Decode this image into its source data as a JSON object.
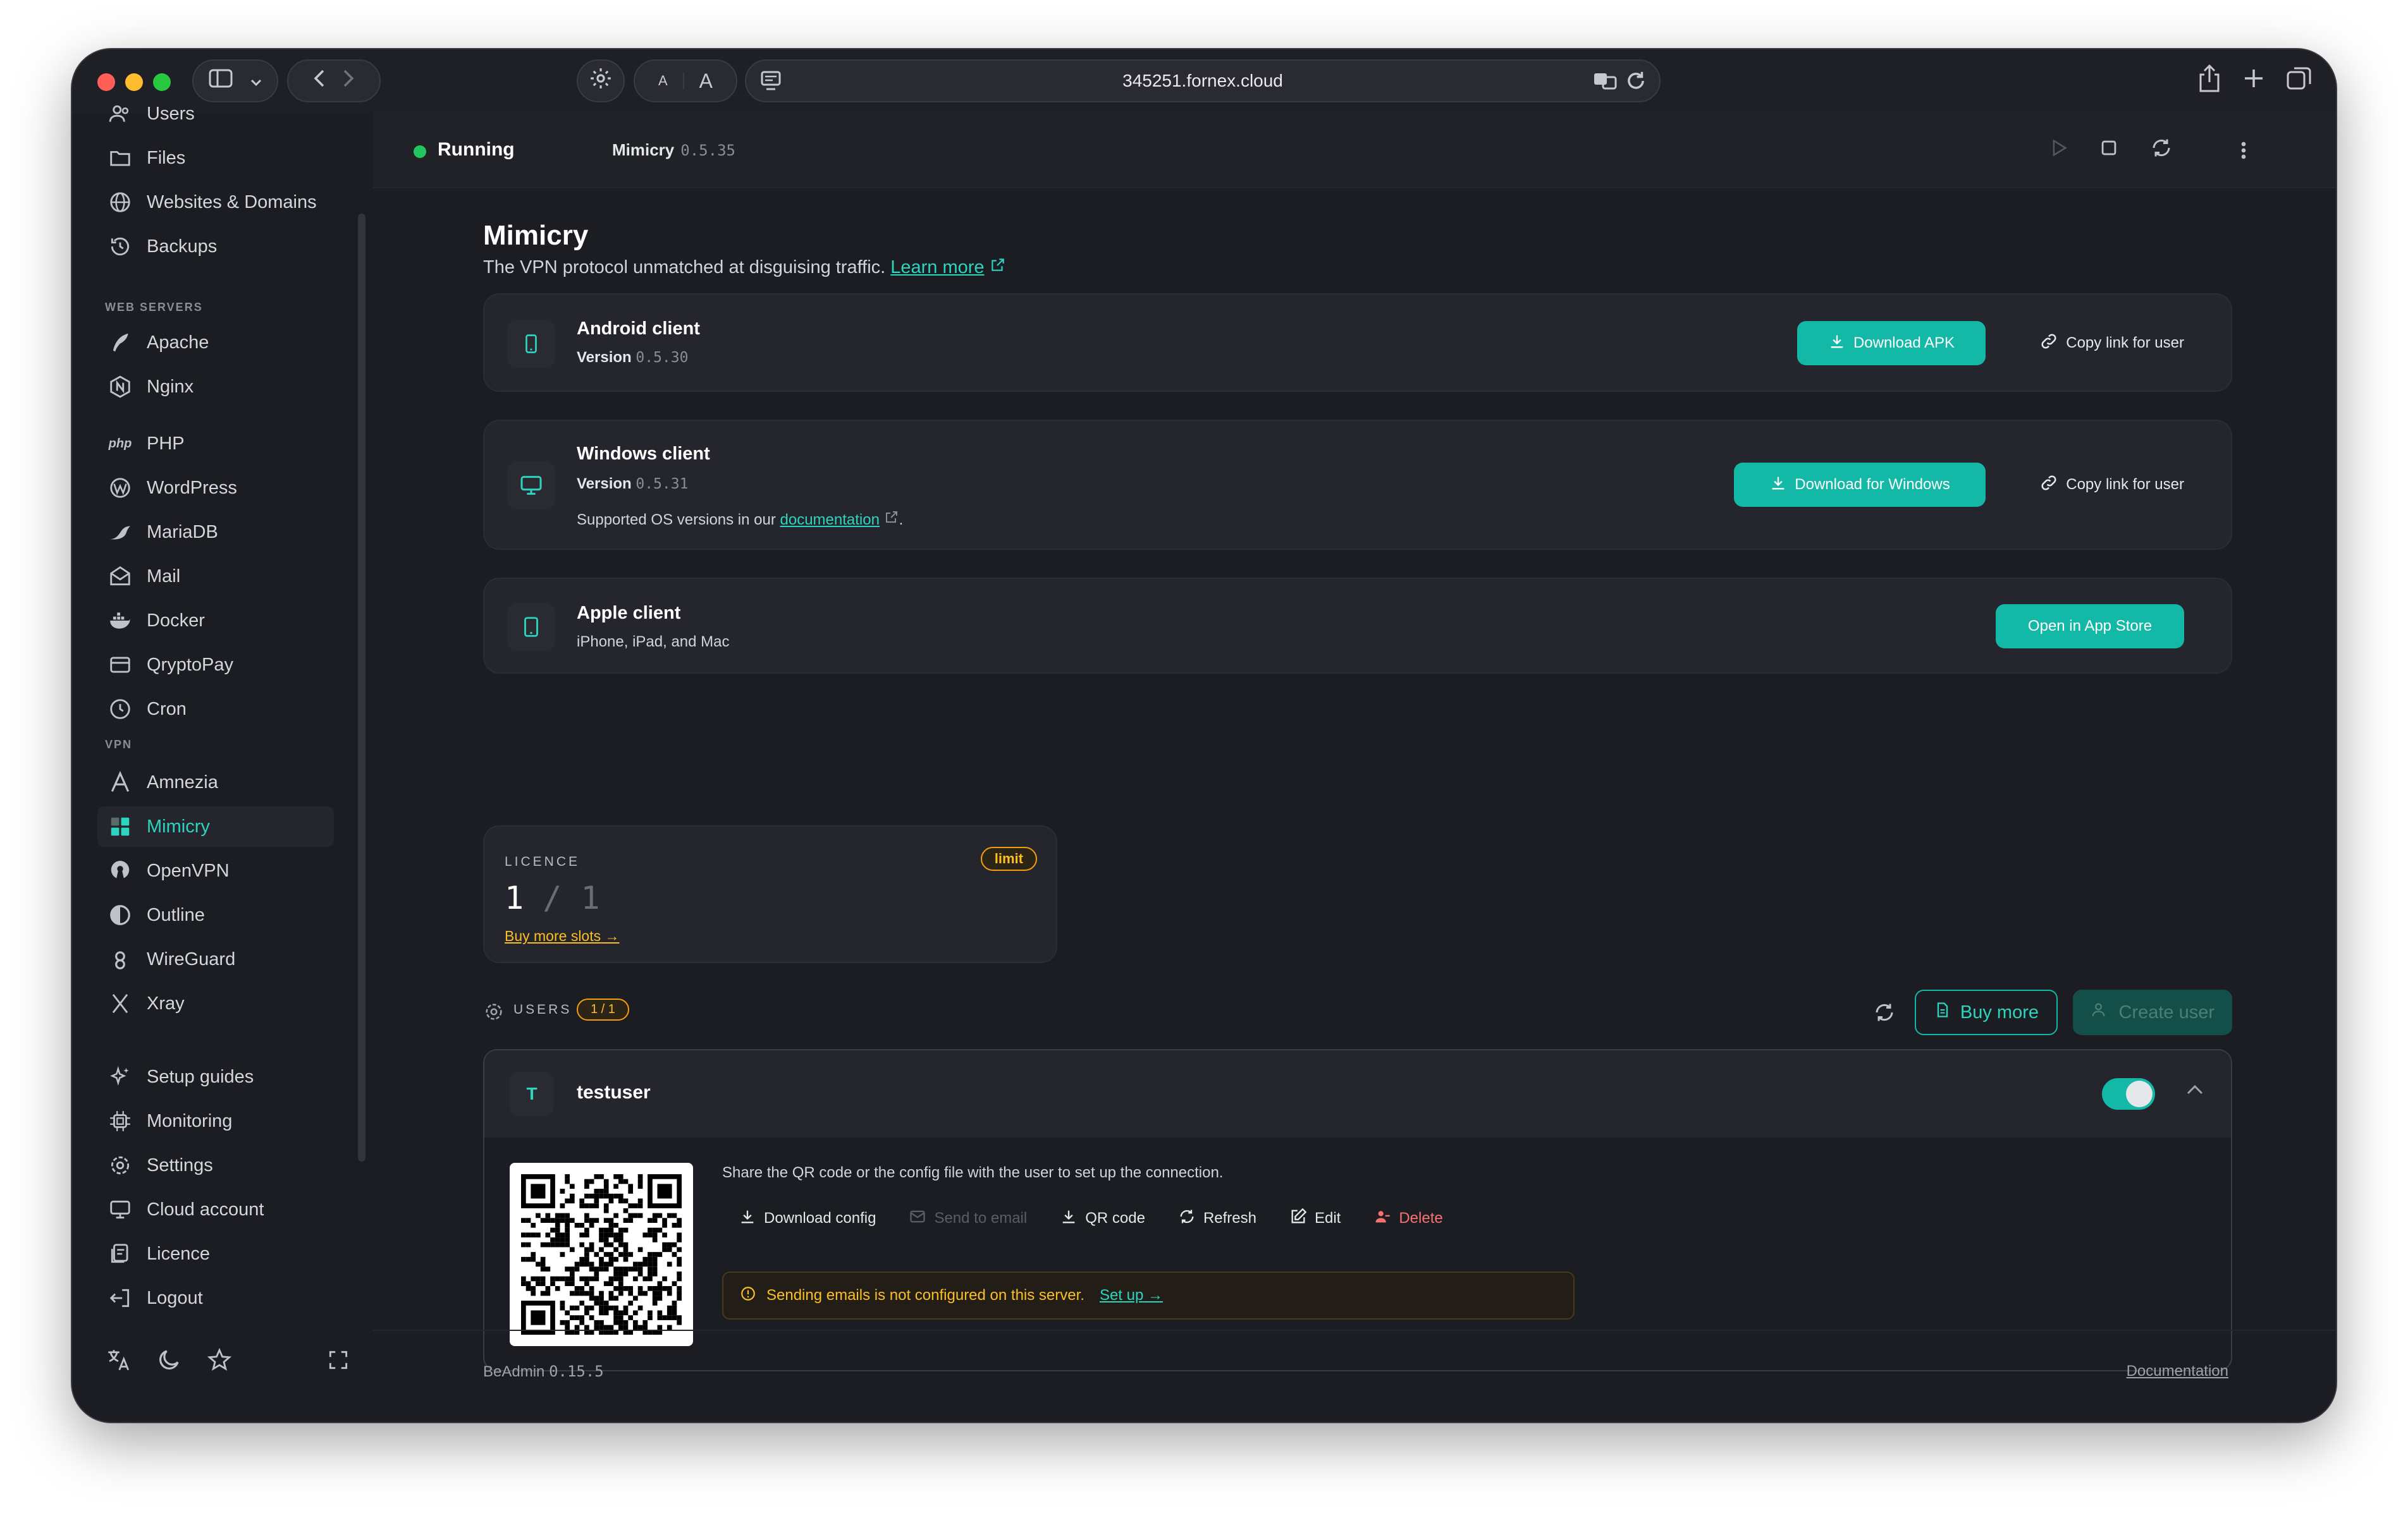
{
  "browser": {
    "url": "345251.fornex.cloud",
    "reader_small": "A",
    "reader_large": "A"
  },
  "sidebar": {
    "top_items": [
      {
        "label": "Users",
        "icon": "users-icon"
      },
      {
        "label": "Files",
        "icon": "folder-icon"
      },
      {
        "label": "Websites & Domains",
        "icon": "globe-icon"
      },
      {
        "label": "Backups",
        "icon": "history-icon"
      }
    ],
    "web_servers_label": "WEB SERVERS",
    "web_servers": [
      {
        "label": "Apache",
        "icon": "feather-icon"
      },
      {
        "label": "Nginx",
        "icon": "nginx-icon"
      }
    ],
    "php_logo": "php",
    "apps": [
      {
        "label": "PHP",
        "icon": "php-icon"
      },
      {
        "label": "WordPress",
        "icon": "wordpress-icon"
      },
      {
        "label": "MariaDB",
        "icon": "mariadb-icon"
      },
      {
        "label": "Mail",
        "icon": "mail-icon"
      },
      {
        "label": "Docker",
        "icon": "docker-icon"
      },
      {
        "label": "QryptoPay",
        "icon": "card-icon"
      },
      {
        "label": "Cron",
        "icon": "clock-icon"
      }
    ],
    "vpn_label": "VPN",
    "vpn": [
      {
        "label": "Amnezia",
        "icon": "amnezia-icon"
      },
      {
        "label": "Mimicry",
        "icon": "grid-icon",
        "active": true
      },
      {
        "label": "OpenVPN",
        "icon": "openvpn-icon"
      },
      {
        "label": "Outline",
        "icon": "outline-icon"
      },
      {
        "label": "WireGuard",
        "icon": "wireguard-icon"
      },
      {
        "label": "Xray",
        "icon": "xray-icon"
      }
    ],
    "bottom_items": [
      {
        "label": "Setup guides",
        "icon": "sparkles-icon"
      },
      {
        "label": "Monitoring",
        "icon": "chip-icon"
      },
      {
        "label": "Settings",
        "icon": "gear-icon"
      },
      {
        "label": "Cloud account",
        "icon": "monitor-icon"
      },
      {
        "label": "Licence",
        "icon": "licence-icon"
      },
      {
        "label": "Logout",
        "icon": "logout-icon"
      }
    ]
  },
  "status": {
    "state": "Running",
    "app_name": "Mimicry",
    "app_version": "0.5.35"
  },
  "page": {
    "title": "Mimicry",
    "subtitle": "The VPN protocol unmatched at disguising traffic.",
    "learn_more": "Learn more"
  },
  "clients": {
    "android": {
      "title": "Android client",
      "version_label": "Version",
      "version": "0.5.30",
      "download_label": "Download APK",
      "copy_label": "Copy link for user"
    },
    "windows": {
      "title": "Windows client",
      "version_label": "Version",
      "version": "0.5.31",
      "os_text": "Supported OS versions in our",
      "os_link": "documentation",
      "os_suffix": ".",
      "download_label": "Download for Windows",
      "copy_label": "Copy link for user"
    },
    "apple": {
      "title": "Apple client",
      "subtitle": "iPhone, iPad, and Mac",
      "store_label": "Open in App Store"
    }
  },
  "licence": {
    "label": "LICENCE",
    "badge": "limit",
    "used": "1",
    "separator": "/",
    "total": "1",
    "buy_link": "Buy more slots"
  },
  "users": {
    "label": "USERS",
    "badge": "1 / 1",
    "buy_more": "Buy more",
    "create_user": "Create user",
    "list": [
      {
        "initial": "T",
        "name": "testuser",
        "enabled": true,
        "share_text": "Share the QR code or the config file with the user to set up the connection.",
        "actions": {
          "download_config": "Download config",
          "send_email": "Send to email",
          "qr_code": "QR code",
          "refresh": "Refresh",
          "edit": "Edit",
          "delete": "Delete"
        },
        "warning": "Sending emails is not configured on this server.",
        "warning_link": "Set up"
      }
    ]
  },
  "footer": {
    "product": "BeAdmin",
    "version": "0.15.5",
    "docs": "Documentation"
  },
  "colors": {
    "accent": "#14b8a6",
    "warning": "#fbbf24",
    "danger": "#f87171",
    "running": "#22c55e"
  }
}
